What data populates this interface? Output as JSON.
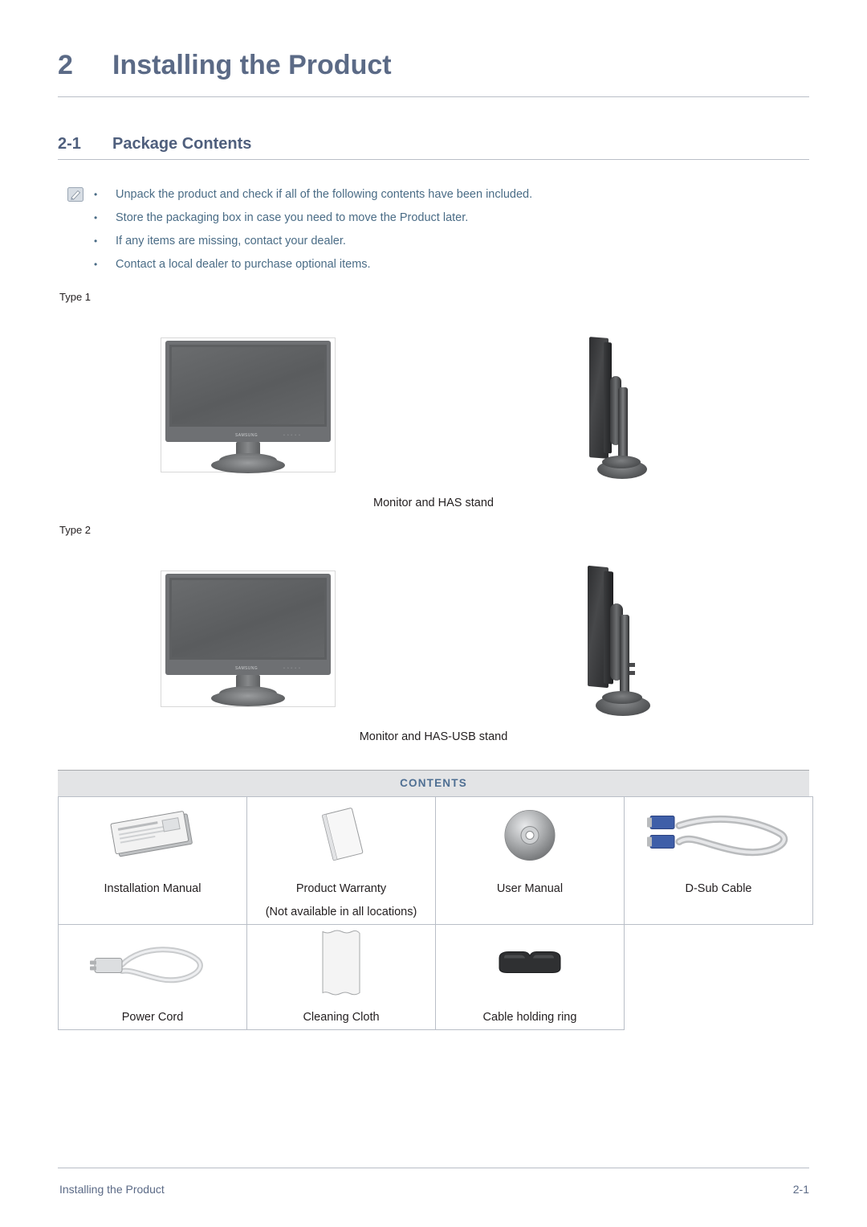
{
  "chapter": {
    "number": "2",
    "title": "Installing the Product"
  },
  "section": {
    "number": "2-1",
    "title": "Package Contents"
  },
  "note": {
    "icon": "note-pencil-icon",
    "items": [
      "Unpack the product and check if all of the following contents have been included.",
      "Store the packaging box in case you need to move the Product later.",
      "If any items are missing, contact your dealer.",
      "Contact a local dealer to purchase optional items."
    ]
  },
  "types": [
    {
      "label": "Type 1",
      "caption": "Monitor and HAS stand",
      "front_image": "monitor-front-illustration",
      "side_image": "monitor-side-illustration"
    },
    {
      "label": "Type 2",
      "caption": "Monitor and HAS-USB stand",
      "front_image": "monitor-front-illustration",
      "side_image": "monitor-side-usb-illustration"
    }
  ],
  "contents_table": {
    "header": "CONTENTS",
    "rows": [
      [
        {
          "image": "installation-manual-icon",
          "label": "Installation Manual",
          "sublabel": ""
        },
        {
          "image": "product-warranty-icon",
          "label": "Product Warranty",
          "sublabel": "(Not available in all locations)"
        },
        {
          "image": "user-manual-cd-icon",
          "label": "User Manual",
          "sublabel": ""
        },
        {
          "image": "d-sub-cable-icon",
          "label": "D-Sub Cable",
          "sublabel": ""
        }
      ],
      [
        {
          "image": "power-cord-icon",
          "label": "Power Cord",
          "sublabel": ""
        },
        {
          "image": "cleaning-cloth-icon",
          "label": "Cleaning Cloth",
          "sublabel": ""
        },
        {
          "image": "cable-holding-ring-icon",
          "label": "Cable holding ring",
          "sublabel": ""
        },
        {
          "image": "",
          "label": "",
          "sublabel": ""
        }
      ]
    ]
  },
  "footer": {
    "left": "Installing the Product",
    "right": "2-1"
  },
  "monitor_labels": {
    "brand": "SAMSUNG",
    "buttons": "▫ ▫ ▫ ▫ ▫"
  },
  "colors": {
    "heading": "#5b6a86",
    "note_text": "#4a6c86",
    "contents_header": "#4f6f93",
    "rule": "#b9bec7"
  }
}
